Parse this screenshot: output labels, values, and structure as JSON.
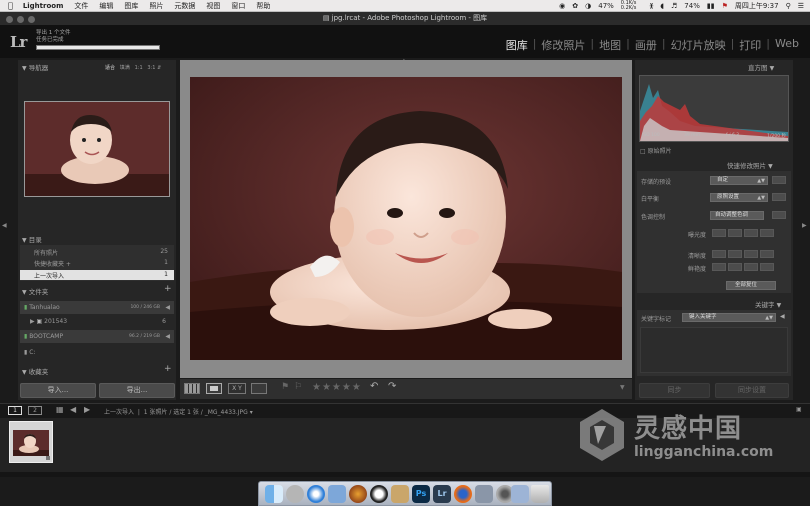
{
  "menubar": {
    "app": "Lightroom",
    "items": [
      "文件",
      "编辑",
      "图库",
      "照片",
      "元数据",
      "视图",
      "窗口",
      "帮助"
    ],
    "battery": "47%",
    "network": "0.1K/s 0.2K/s",
    "volume": "74%",
    "clock": "周四上午9:37"
  },
  "window": {
    "title": "jpg.lrcat - Adobe Photoshop Lightroom - 图库"
  },
  "header": {
    "logo": "Lr",
    "task_line1": "导出 1 个文件",
    "task_line2": "任务已完成",
    "progress": 1.0,
    "modules": [
      "图库",
      "修改照片",
      "地图",
      "画册",
      "幻灯片放映",
      "打印",
      "Web"
    ],
    "active_module": "图库"
  },
  "navigator": {
    "title": "导航器",
    "zoom_options": [
      "适合",
      "填满",
      "1:1",
      "3:1"
    ]
  },
  "catalog": {
    "title": "目录",
    "items": [
      {
        "label": "所有照片",
        "count": "25"
      },
      {
        "label": "快捷收藏夹 +",
        "count": "1"
      },
      {
        "label": "上一次导入",
        "count": "1"
      }
    ]
  },
  "folders": {
    "title": "文件夹",
    "volumes": [
      {
        "name": "Tanhualao",
        "space": "100 / 246 GB"
      },
      {
        "name": "BOOTCAMP",
        "space": "96.2 / 219 GB"
      }
    ],
    "subfolder": {
      "name": "201543",
      "count": "6"
    },
    "c_drive": "C:"
  },
  "collections": {
    "title": "收藏夹"
  },
  "left_buttons": {
    "import": "导入...",
    "export": "导出..."
  },
  "histogram": {
    "title": "直方图",
    "iso": "ISO 100",
    "focal": "39 mm",
    "aperture": "f / 6.3",
    "shutter": "1/200 秒",
    "original_photo": "原始照片"
  },
  "quick_develop": {
    "title": "快速修改照片",
    "saved_preset_label": "存储的预设",
    "saved_preset_value": "自定",
    "wb_label": "白平衡",
    "wb_value": "原照设置",
    "tone_label": "色调控制",
    "tone_value": "自动调整色调",
    "exposure_label": "曝光度",
    "clarity_label": "清晰度",
    "vibrance_label": "鲜艳度",
    "reset": "全部复位"
  },
  "keywords": {
    "title": "关键字",
    "label": "关键字标记",
    "value": "键入关键字"
  },
  "right_buttons": {
    "sync": "同步",
    "sync_settings": "同步设置"
  },
  "filmstrip_bar": {
    "page1": "1",
    "page2": "2",
    "source": "上一次导入",
    "info": "1 张照片 / 选定 1 张 / _MG_4433.JPG"
  },
  "watermark": {
    "cn": "灵感中国",
    "url": "lingganchina.com"
  },
  "colors": {
    "menubar": "#eceaea",
    "panel": "#2a2a2a",
    "photo_bg": "#5b2b2a",
    "active_text": "#e8e8e8"
  }
}
